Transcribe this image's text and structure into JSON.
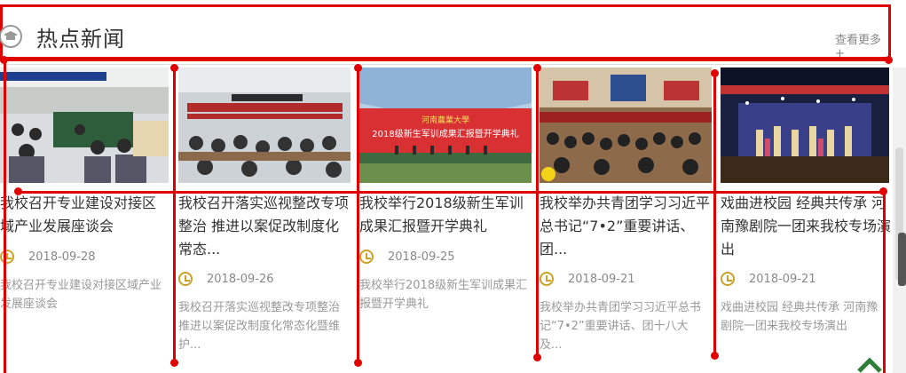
{
  "section": {
    "title": "热点新闻",
    "more_label": "查看更多+"
  },
  "news": [
    {
      "title": "我校召开专业建设对接区域产业发展座谈会",
      "date": "2018-09-28",
      "summary": "我校召开专业建设对接区域产业发展座谈会"
    },
    {
      "title": "我校召开落实巡视整改专项整治 推进以案促改制度化常态...",
      "date": "2018-09-26",
      "summary": "我校召开落实巡视整改专项整治 推进以案促改制度化常态化暨维护..."
    },
    {
      "title": "我校举行2018级新生军训成果汇报暨开学典礼",
      "date": "2018-09-25",
      "summary": "我校举行2018级新生军训成果汇报暨开学典礼"
    },
    {
      "title": "我校举办共青团学习习近平总书记“7•2”重要讲话、团...",
      "date": "2018-09-21",
      "summary": "我校举办共青团学习习近平总书记“7•2”重要讲话、团十八大及..."
    },
    {
      "title": "戏曲进校园 经典共传承 河南豫剧院一团来我校专场演出",
      "date": "2018-09-21",
      "summary": "戏曲进校园 经典共传承 河南豫剧院一团来我校专场演出"
    }
  ],
  "photo_banners": [
    "2018级新生军训成果汇报暨开学典礼"
  ],
  "colors": {
    "accent_red": "#e00000",
    "clock_gold": "#c9a227",
    "text_dark": "#333333",
    "text_muted": "#999999"
  }
}
